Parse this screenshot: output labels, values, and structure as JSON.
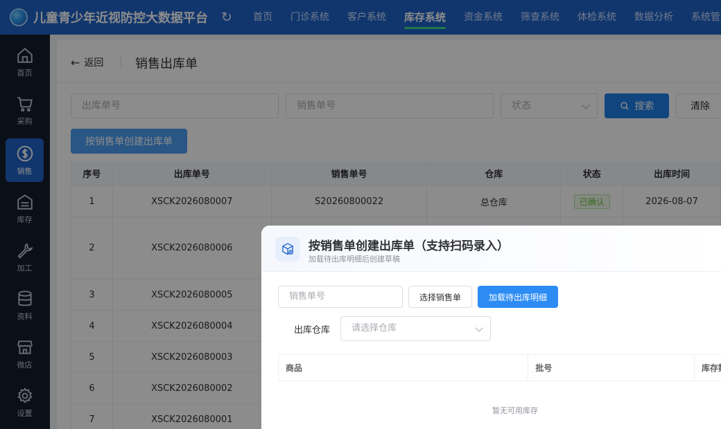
{
  "app": {
    "title": "儿童青少年近视防控大数据平台"
  },
  "topnav": [
    "首页",
    "门诊系统",
    "客户系统",
    "库存系统",
    "资金系统",
    "筛查系统",
    "体检系统",
    "数据分析",
    "系统管理"
  ],
  "sidebar": [
    "首页",
    "采购",
    "销售",
    "库存",
    "加工",
    "资料",
    "微店",
    "设置"
  ],
  "page": {
    "back": "返回",
    "title": "销售出库单"
  },
  "filters": {
    "out_no_placeholder": "出库单号",
    "sale_no_placeholder": "销售单号",
    "status_placeholder": "状态",
    "search": "搜索",
    "clear": "清除",
    "create": "按销售单创建出库单"
  },
  "table": {
    "headers": [
      "序号",
      "出库单号",
      "销售单号",
      "仓库",
      "状态",
      "出库时间"
    ],
    "rows": [
      {
        "no": "1",
        "out_no": "XSCK2026080007",
        "sale_no": "S20260800022",
        "warehouse": "总仓库",
        "status": "已确认",
        "time": "2026-08-07"
      },
      {
        "no": "2",
        "out_no": "XSCK2026080006",
        "sale_no": "",
        "warehouse": "",
        "status": "",
        "time": ""
      },
      {
        "no": "3",
        "out_no": "XSCK2026080005",
        "sale_no": "",
        "warehouse": "",
        "status": "",
        "time": ""
      },
      {
        "no": "4",
        "out_no": "XSCK2026080004",
        "sale_no": "",
        "warehouse": "",
        "status": "",
        "time": ""
      },
      {
        "no": "5",
        "out_no": "XSCK2026080003",
        "sale_no": "",
        "warehouse": "",
        "status": "",
        "time": ""
      },
      {
        "no": "6",
        "out_no": "XSCK2026080002",
        "sale_no": "",
        "warehouse": "",
        "status": "",
        "time": ""
      },
      {
        "no": "7",
        "out_no": "XSCK2026080001",
        "sale_no": "",
        "warehouse": "",
        "status": "",
        "time": ""
      }
    ]
  },
  "dialog": {
    "title": "按销售单创建出库单（支持扫码录入）",
    "subtitle": "加载待出库明细后创建草稿",
    "sale_no_placeholder": "销售单号",
    "choose_btn": "选择销售单",
    "load_btn": "加载待出库明细",
    "warehouse_label": "出库仓库",
    "warehouse_placeholder": "请选择仓库",
    "headers": [
      "商品",
      "批号",
      "库存数"
    ],
    "empty": "暂无可用库存"
  },
  "colors": {
    "primary": "#1f63c6",
    "accent": "#3ddc84",
    "sidebar_bg": "#151d2b"
  }
}
